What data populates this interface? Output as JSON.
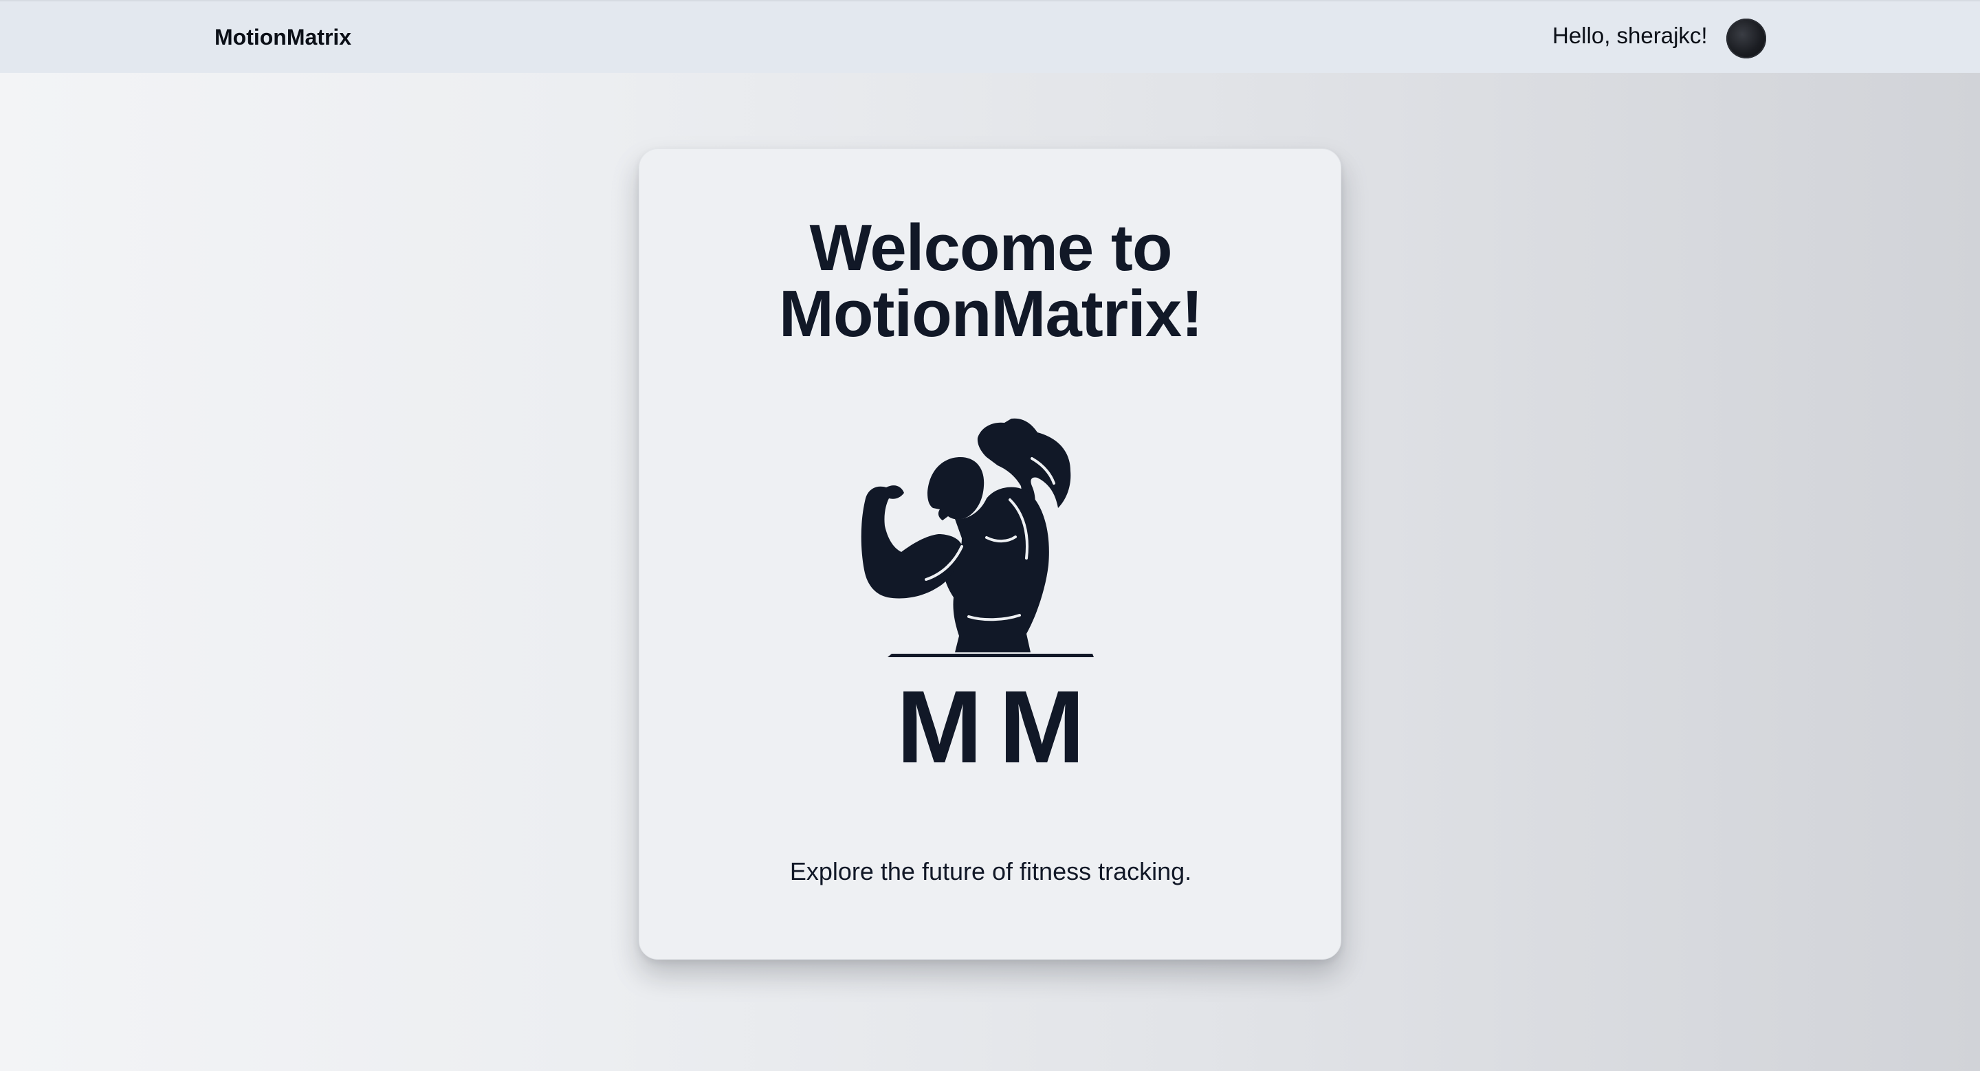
{
  "navbar": {
    "brand": "MotionMatrix",
    "greeting": "Hello, sherajkc!",
    "avatar_icon": "user-avatar"
  },
  "card": {
    "title_line1": "Welcome to",
    "title_line2": "MotionMatrix!",
    "logo_icon": "bodybuilder-flex-icon",
    "logo_text": "MM",
    "subtitle": "Explore the future of fitness tracking."
  },
  "colors": {
    "text_dark": "#111827",
    "navbar_bg": "#e3e8ef",
    "card_bg": "#eef0f3"
  }
}
